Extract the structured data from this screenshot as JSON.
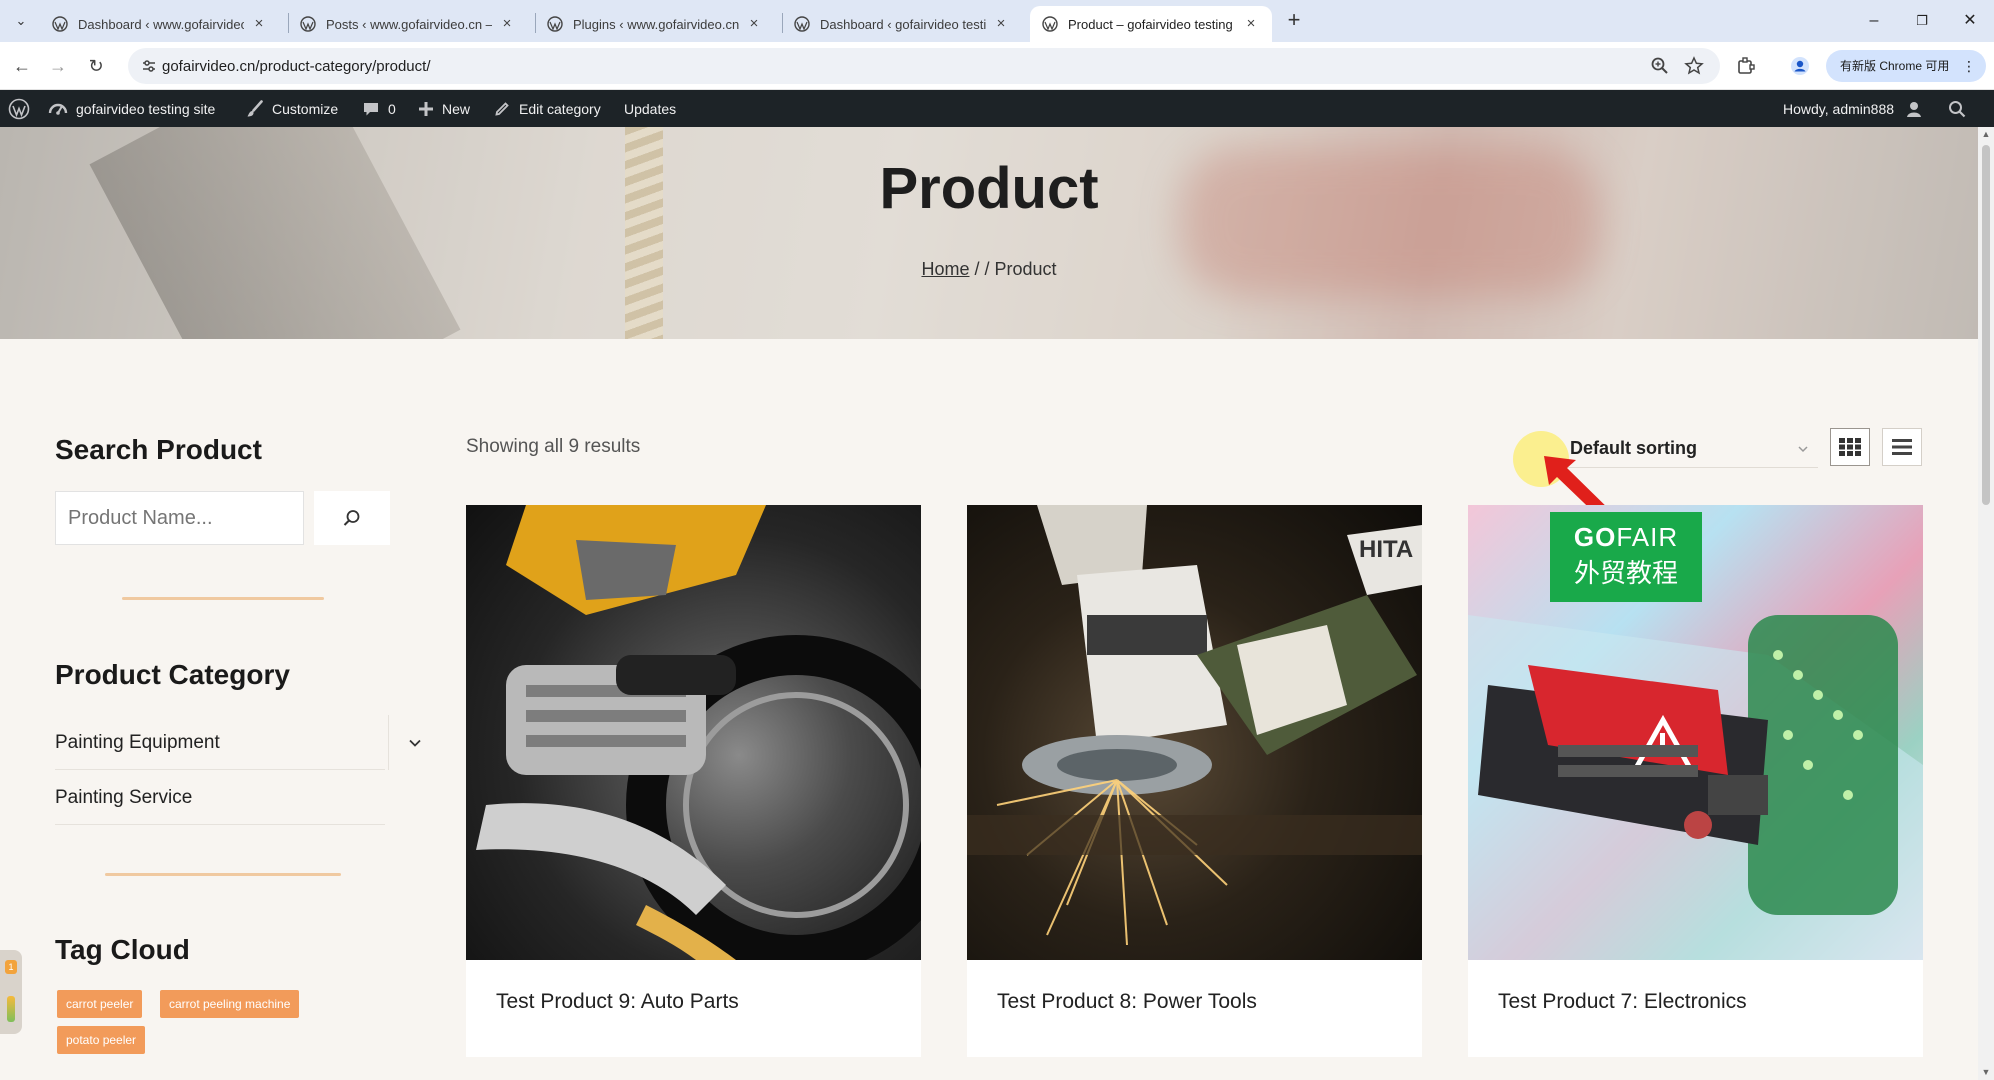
{
  "browser": {
    "tabs": [
      {
        "title": "Dashboard ‹ www.gofairvideo",
        "active": false
      },
      {
        "title": "Posts ‹ www.gofairvideo.cn —",
        "active": false
      },
      {
        "title": "Plugins ‹ www.gofairvideo.cn",
        "active": false
      },
      {
        "title": "Dashboard ‹ gofairvideo testi",
        "active": false
      },
      {
        "title": "Product – gofairvideo testing",
        "active": true
      }
    ],
    "url": "gofairvideo.cn/product-category/product/",
    "upgrade_label": "有新版 Chrome 可用"
  },
  "adminbar": {
    "site_name": "gofairvideo testing site",
    "customize": "Customize",
    "comments_count": "0",
    "new": "New",
    "edit_category": "Edit category",
    "updates": "Updates",
    "howdy": "Howdy, admin888"
  },
  "hero": {
    "title": "Product",
    "breadcrumb_home": "Home",
    "breadcrumb_rest": " / / Product"
  },
  "sidebar": {
    "search_heading": "Search Product",
    "search_placeholder": "Product Name...",
    "category_heading": "Product Category",
    "categories": [
      {
        "label": "Painting Equipment",
        "has_children": true
      },
      {
        "label": "Painting Service",
        "has_children": false
      }
    ],
    "tag_heading": "Tag Cloud",
    "tags": [
      "carrot peeler",
      "carrot peeling machine",
      "potato peeler"
    ]
  },
  "shop": {
    "result_count": "Showing all 9 results",
    "sorting": "Default sorting",
    "view_modes": [
      "grid",
      "list"
    ],
    "products": [
      {
        "name": "Test Product 9: Auto Parts",
        "image": "motorcycle-engine"
      },
      {
        "name": "Test Product 8: Power Tools",
        "image": "angle-grinder-sparks"
      },
      {
        "name": "Test Product 7: Electronics",
        "image": "electronic-device"
      }
    ]
  },
  "watermark": {
    "brand_a": "GO",
    "brand_b": "FAIR",
    "brand_cn": "外贸教程"
  },
  "colors": {
    "accent_tag": "#f29b5a",
    "divider": "#f0c9a0",
    "adminbar": "#1d2327",
    "page_bg": "#f8f5f1"
  }
}
